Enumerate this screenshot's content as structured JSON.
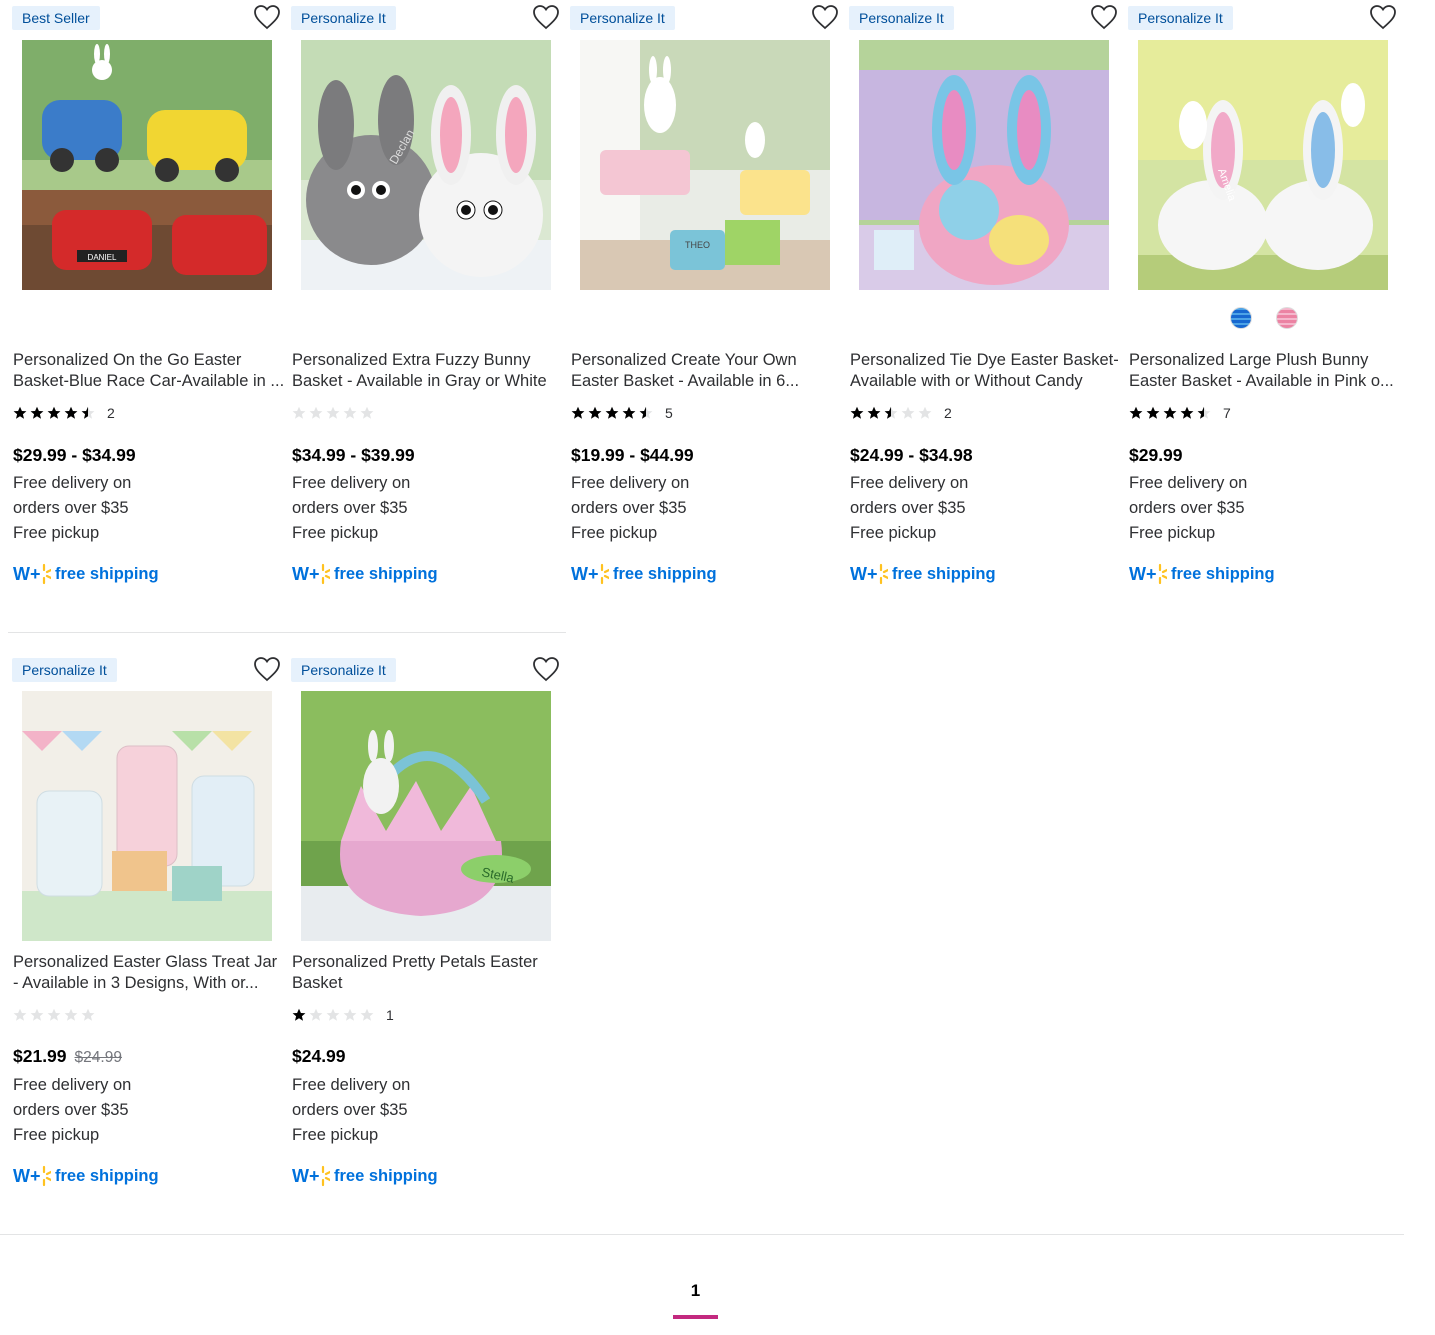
{
  "products": [
    {
      "badge": "Best Seller",
      "title": "Personalized On the Go Easter Basket-Blue Race Car-Available in ...",
      "rating_count": "2",
      "stars": [
        1,
        1,
        1,
        1,
        0.5
      ],
      "price": "$29.99 - $34.99",
      "was_price": "",
      "delivery_line1": "Free delivery on",
      "delivery_line2": "orders over $35",
      "pickup": "Free pickup",
      "free_shipping": "free shipping",
      "image_label": "DANIEL"
    },
    {
      "badge": "Personalize It",
      "title": "Personalized Extra Fuzzy Bunny Basket - Available in Gray or White",
      "rating_count": "",
      "stars": [
        0,
        0,
        0,
        0,
        0
      ],
      "price": "$34.99 - $39.99",
      "was_price": "",
      "delivery_line1": "Free delivery on",
      "delivery_line2": "orders over $35",
      "pickup": "Free pickup",
      "free_shipping": "free shipping",
      "image_label": "Declan"
    },
    {
      "badge": "Personalize It",
      "title": "Personalized Create Your Own Easter Basket - Available in 6...",
      "rating_count": "5",
      "stars": [
        1,
        1,
        1,
        1,
        0.5
      ],
      "price": "$19.99 - $44.99",
      "was_price": "",
      "delivery_line1": "Free delivery on",
      "delivery_line2": "orders over $35",
      "pickup": "Free pickup",
      "free_shipping": "free shipping",
      "image_label": "THEO"
    },
    {
      "badge": "Personalize It",
      "title": "Personalized Tie Dye Easter Basket- Available with or Without Candy",
      "rating_count": "2",
      "stars": [
        1,
        1,
        0.5,
        0,
        0
      ],
      "price": "$24.99 - $34.98",
      "was_price": "",
      "delivery_line1": "Free delivery on",
      "delivery_line2": "orders over $35",
      "pickup": "Free pickup",
      "free_shipping": "free shipping",
      "image_label": ""
    },
    {
      "badge": "Personalize It",
      "title": "Personalized Large Plush Bunny Easter Basket - Available in Pink o...",
      "rating_count": "7",
      "stars": [
        1,
        1,
        1,
        1,
        0.5
      ],
      "price": "$29.99",
      "was_price": "",
      "delivery_line1": "Free delivery on",
      "delivery_line2": "orders over $35",
      "pickup": "Free pickup",
      "free_shipping": "free shipping",
      "image_label": "Amelia",
      "swatch_colors": [
        "#4da3e6",
        "#f5b7cc"
      ]
    },
    {
      "badge": "Personalize It",
      "title": "Personalized Easter Glass Treat Jar - Available in 3 Designs, With or...",
      "rating_count": "",
      "stars": [
        0,
        0,
        0,
        0,
        0
      ],
      "price": "$21.99",
      "was_price": "$24.99",
      "delivery_line1": "Free delivery on",
      "delivery_line2": "orders over $35",
      "pickup": "Free pickup",
      "free_shipping": "free shipping",
      "image_label": ""
    },
    {
      "badge": "Personalize It",
      "title": "Personalized Pretty Petals Easter Basket",
      "rating_count": "1",
      "stars": [
        1,
        0,
        0,
        0,
        0
      ],
      "price": "$24.99",
      "was_price": "",
      "delivery_line1": "Free delivery on",
      "delivery_line2": "orders over $35",
      "pickup": "Free pickup",
      "free_shipping": "free shipping",
      "image_label": "Stella"
    }
  ],
  "pagination": {
    "current": "1"
  },
  "colors": {
    "accent_blue": "#0071dc",
    "badge_bg": "#e6f1fc",
    "badge_text": "#004f9a",
    "spark_yellow": "#ffc220",
    "page_indicator": "#c3297f"
  }
}
